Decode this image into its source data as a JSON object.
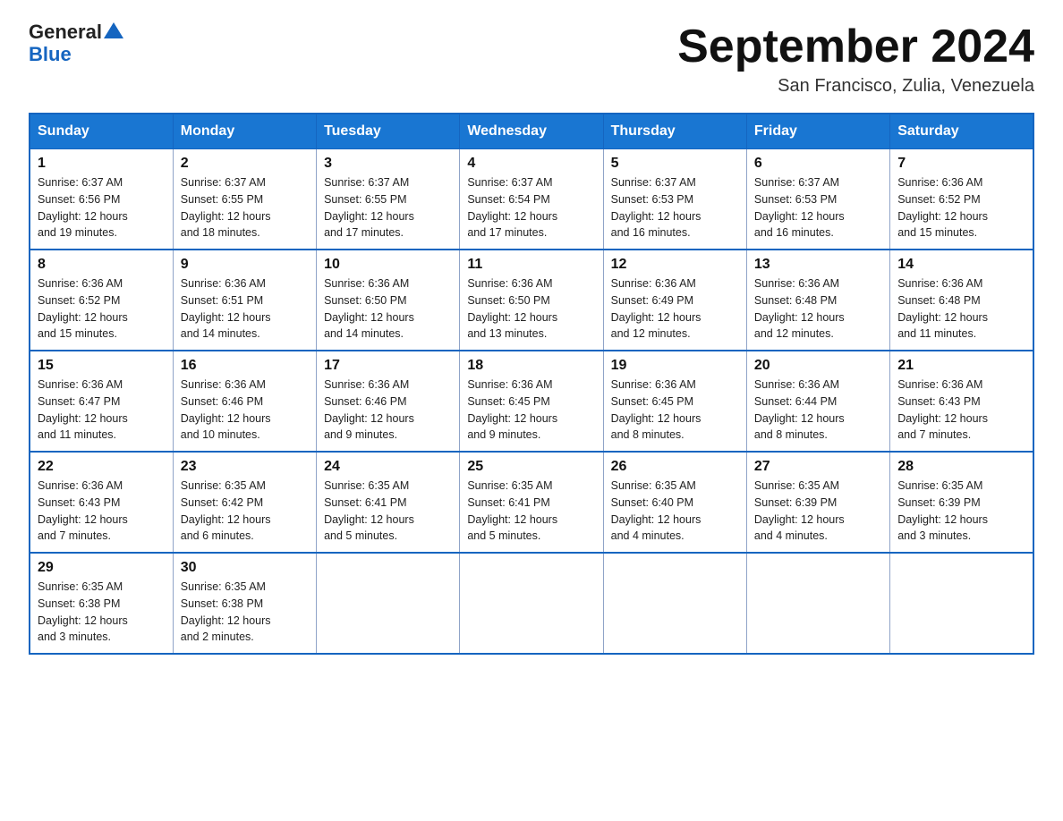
{
  "logo": {
    "line1": "General",
    "triangle": "▲",
    "line2": "Blue"
  },
  "title": "September 2024",
  "location": "San Francisco, Zulia, Venezuela",
  "days_of_week": [
    "Sunday",
    "Monday",
    "Tuesday",
    "Wednesday",
    "Thursday",
    "Friday",
    "Saturday"
  ],
  "weeks": [
    [
      {
        "day": "1",
        "sunrise": "6:37 AM",
        "sunset": "6:56 PM",
        "daylight": "12 hours and 19 minutes."
      },
      {
        "day": "2",
        "sunrise": "6:37 AM",
        "sunset": "6:55 PM",
        "daylight": "12 hours and 18 minutes."
      },
      {
        "day": "3",
        "sunrise": "6:37 AM",
        "sunset": "6:55 PM",
        "daylight": "12 hours and 17 minutes."
      },
      {
        "day": "4",
        "sunrise": "6:37 AM",
        "sunset": "6:54 PM",
        "daylight": "12 hours and 17 minutes."
      },
      {
        "day": "5",
        "sunrise": "6:37 AM",
        "sunset": "6:53 PM",
        "daylight": "12 hours and 16 minutes."
      },
      {
        "day": "6",
        "sunrise": "6:37 AM",
        "sunset": "6:53 PM",
        "daylight": "12 hours and 16 minutes."
      },
      {
        "day": "7",
        "sunrise": "6:36 AM",
        "sunset": "6:52 PM",
        "daylight": "12 hours and 15 minutes."
      }
    ],
    [
      {
        "day": "8",
        "sunrise": "6:36 AM",
        "sunset": "6:52 PM",
        "daylight": "12 hours and 15 minutes."
      },
      {
        "day": "9",
        "sunrise": "6:36 AM",
        "sunset": "6:51 PM",
        "daylight": "12 hours and 14 minutes."
      },
      {
        "day": "10",
        "sunrise": "6:36 AM",
        "sunset": "6:50 PM",
        "daylight": "12 hours and 14 minutes."
      },
      {
        "day": "11",
        "sunrise": "6:36 AM",
        "sunset": "6:50 PM",
        "daylight": "12 hours and 13 minutes."
      },
      {
        "day": "12",
        "sunrise": "6:36 AM",
        "sunset": "6:49 PM",
        "daylight": "12 hours and 12 minutes."
      },
      {
        "day": "13",
        "sunrise": "6:36 AM",
        "sunset": "6:48 PM",
        "daylight": "12 hours and 12 minutes."
      },
      {
        "day": "14",
        "sunrise": "6:36 AM",
        "sunset": "6:48 PM",
        "daylight": "12 hours and 11 minutes."
      }
    ],
    [
      {
        "day": "15",
        "sunrise": "6:36 AM",
        "sunset": "6:47 PM",
        "daylight": "12 hours and 11 minutes."
      },
      {
        "day": "16",
        "sunrise": "6:36 AM",
        "sunset": "6:46 PM",
        "daylight": "12 hours and 10 minutes."
      },
      {
        "day": "17",
        "sunrise": "6:36 AM",
        "sunset": "6:46 PM",
        "daylight": "12 hours and 9 minutes."
      },
      {
        "day": "18",
        "sunrise": "6:36 AM",
        "sunset": "6:45 PM",
        "daylight": "12 hours and 9 minutes."
      },
      {
        "day": "19",
        "sunrise": "6:36 AM",
        "sunset": "6:45 PM",
        "daylight": "12 hours and 8 minutes."
      },
      {
        "day": "20",
        "sunrise": "6:36 AM",
        "sunset": "6:44 PM",
        "daylight": "12 hours and 8 minutes."
      },
      {
        "day": "21",
        "sunrise": "6:36 AM",
        "sunset": "6:43 PM",
        "daylight": "12 hours and 7 minutes."
      }
    ],
    [
      {
        "day": "22",
        "sunrise": "6:36 AM",
        "sunset": "6:43 PM",
        "daylight": "12 hours and 7 minutes."
      },
      {
        "day": "23",
        "sunrise": "6:35 AM",
        "sunset": "6:42 PM",
        "daylight": "12 hours and 6 minutes."
      },
      {
        "day": "24",
        "sunrise": "6:35 AM",
        "sunset": "6:41 PM",
        "daylight": "12 hours and 5 minutes."
      },
      {
        "day": "25",
        "sunrise": "6:35 AM",
        "sunset": "6:41 PM",
        "daylight": "12 hours and 5 minutes."
      },
      {
        "day": "26",
        "sunrise": "6:35 AM",
        "sunset": "6:40 PM",
        "daylight": "12 hours and 4 minutes."
      },
      {
        "day": "27",
        "sunrise": "6:35 AM",
        "sunset": "6:39 PM",
        "daylight": "12 hours and 4 minutes."
      },
      {
        "day": "28",
        "sunrise": "6:35 AM",
        "sunset": "6:39 PM",
        "daylight": "12 hours and 3 minutes."
      }
    ],
    [
      {
        "day": "29",
        "sunrise": "6:35 AM",
        "sunset": "6:38 PM",
        "daylight": "12 hours and 3 minutes."
      },
      {
        "day": "30",
        "sunrise": "6:35 AM",
        "sunset": "6:38 PM",
        "daylight": "12 hours and 2 minutes."
      },
      null,
      null,
      null,
      null,
      null
    ]
  ],
  "colors": {
    "header_bg": "#1976d2",
    "header_border": "#1565c0",
    "row_divider": "#1565c0"
  }
}
